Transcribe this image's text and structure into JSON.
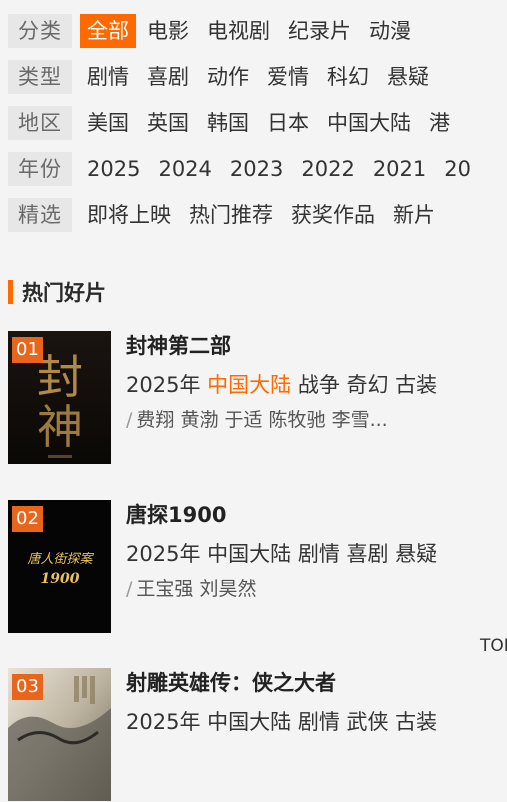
{
  "filters": [
    {
      "label": "分类",
      "options": [
        "全部",
        "电影",
        "电视剧",
        "纪录片",
        "动漫"
      ],
      "selected": 0
    },
    {
      "label": "类型",
      "options": [
        "剧情",
        "喜剧",
        "动作",
        "爱情",
        "科幻",
        "悬疑"
      ],
      "selected": -1
    },
    {
      "label": "地区",
      "options": [
        "美国",
        "英国",
        "韩国",
        "日本",
        "中国大陆",
        "港"
      ],
      "selected": -1
    },
    {
      "label": "年份",
      "options": [
        "2025",
        "2024",
        "2023",
        "2022",
        "2021",
        "20"
      ],
      "selected": -1
    },
    {
      "label": "精选",
      "options": [
        "即将上映",
        "热门推荐",
        "获奖作品",
        "新片"
      ],
      "selected": -1
    }
  ],
  "section": {
    "title": "热门好片"
  },
  "movies": [
    {
      "rank": "01",
      "title": "封神第二部",
      "year": "2025年",
      "region": "中国大陆",
      "region_highlight": true,
      "genres": "战争 奇幻 古装",
      "cast": "费翔 黄渤 于适 陈牧驰 李雪...",
      "poster_text": "封神"
    },
    {
      "rank": "02",
      "title": "唐探1900",
      "year": "2025年",
      "region": "中国大陆",
      "region_highlight": false,
      "genres": "剧情 喜剧 悬疑",
      "cast": "王宝强 刘昊然",
      "poster_text": "唐人街探案 1900"
    },
    {
      "rank": "03",
      "title": "射雕英雄传：侠之大者",
      "year": "2025年",
      "region": "中国大陆",
      "region_highlight": false,
      "genres": "剧情 武侠 古装",
      "cast": "",
      "poster_text": ""
    }
  ],
  "top_link": "TOP",
  "colors": {
    "accent": "#ff6a00",
    "label_bg": "#e7e7e7",
    "page_bg": "#f4f4f4"
  }
}
